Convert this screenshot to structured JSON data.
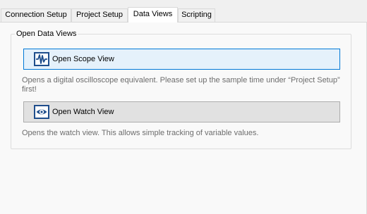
{
  "tabs": [
    {
      "label": "Connection Setup",
      "active": false
    },
    {
      "label": "Project Setup",
      "active": false
    },
    {
      "label": "Data Views",
      "active": true
    },
    {
      "label": "Scripting",
      "active": false
    }
  ],
  "group": {
    "title": "Open Data Views",
    "scope": {
      "button_label": "Open Scope View",
      "icon": "oscilloscope-icon",
      "description": "Opens a digital oscilloscope equivalent. Please set up the sample time under “Project Setup” first!"
    },
    "watch": {
      "button_label": "Open Watch View",
      "icon": "eye-icon",
      "description": "Opens the watch view. This allows simple tracking of variable values."
    }
  },
  "colors": {
    "icon_blue": "#1f4e8c",
    "focus_border": "#0078d7",
    "hover_fill": "#e5f1fb"
  }
}
